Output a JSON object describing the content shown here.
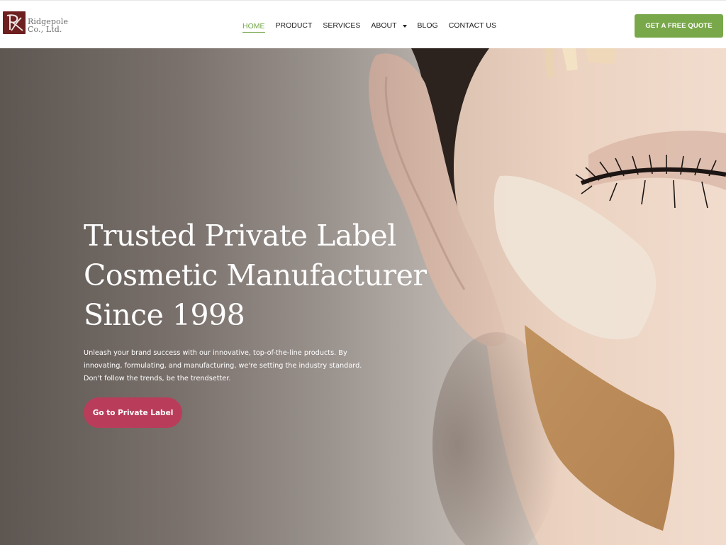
{
  "brand": {
    "name_line1": "Ridgepole",
    "name_line2": "Co., Ltd.",
    "logo_color": "#6e1f1f"
  },
  "nav": {
    "items": [
      {
        "label": "HOME",
        "active": true
      },
      {
        "label": "PRODUCT",
        "active": false
      },
      {
        "label": "SERVICES",
        "active": false
      },
      {
        "label": "ABOUT",
        "active": false,
        "dropdown": true
      },
      {
        "label": "BLOG",
        "active": false
      },
      {
        "label": "CONTACT US",
        "active": false
      }
    ],
    "active_color": "#72a548",
    "dropdown_icon": "chevron-down-icon"
  },
  "header": {
    "cta_label": "GET A FREE QUOTE",
    "cta_color": "#79a84a"
  },
  "hero": {
    "title_lines": [
      "Trusted Private Label",
      "Cosmetic Manufacturer",
      "Since 1998"
    ],
    "description_lines": [
      "Unleash your brand success with our innovative, top-of-the-line products. By",
      "innovating, formulating, and manufacturing, we're setting the industry standard.",
      "Don't follow the trends, be the trendsetter."
    ],
    "cta_label": "Go to Private Label",
    "cta_color": "#b93d5b"
  }
}
